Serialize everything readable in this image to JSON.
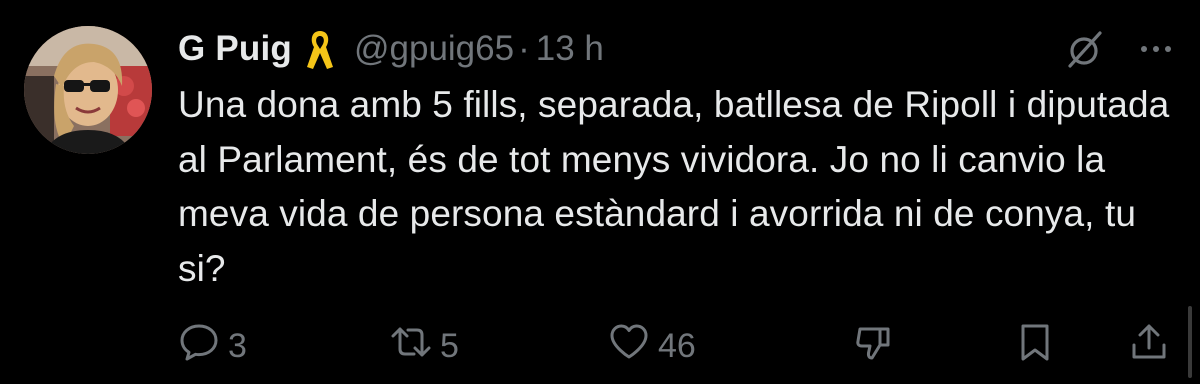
{
  "tweet": {
    "author": {
      "display_name": "G Puig",
      "badge_icon": "yellow-ribbon-icon",
      "handle": "@gpuig65",
      "separator": "·",
      "time": "13 h"
    },
    "text": "Una dona amb 5 fills, separada, batllesa de Ripoll i diputada al Parlament, és de tot menys vividora. Jo no li canvio la meva vida de persona estàndard i avorrida ni de conya, tu si?",
    "actions": {
      "replies": "3",
      "reposts": "5",
      "likes": "46"
    },
    "icons": [
      "grok-icon",
      "more-icon",
      "reply-icon",
      "repost-icon",
      "like-icon",
      "dislike-icon",
      "bookmark-icon",
      "share-icon"
    ]
  },
  "colors": {
    "background": "#000000",
    "text": "#e7e9ea",
    "secondary": "#71767b",
    "ribbon": "#f5c518"
  }
}
